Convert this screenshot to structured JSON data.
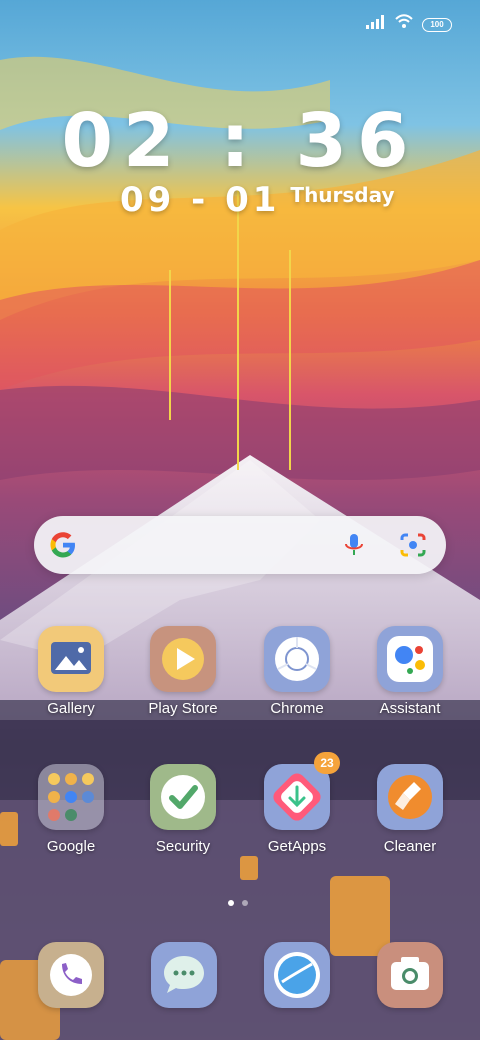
{
  "status_bar": {
    "battery": "100"
  },
  "lock_clock": {
    "time": "02 : 36",
    "date": "09 - 01",
    "weekday": "Thursday"
  },
  "search": {
    "placeholder": ""
  },
  "apps": [
    {
      "label": "Gallery"
    },
    {
      "label": "Play Store"
    },
    {
      "label": "Chrome"
    },
    {
      "label": "Assistant"
    },
    {
      "label": "Google"
    },
    {
      "label": "Security"
    },
    {
      "label": "GetApps",
      "badge": "23"
    },
    {
      "label": "Cleaner"
    }
  ],
  "page_indicator": {
    "pages": 2,
    "active": 1
  },
  "dock": [
    "phone-icon",
    "messages-icon",
    "browser-icon",
    "camera-icon"
  ],
  "colors": {
    "search_bg": "#f4f4f7",
    "badge": "#f5a33b"
  }
}
